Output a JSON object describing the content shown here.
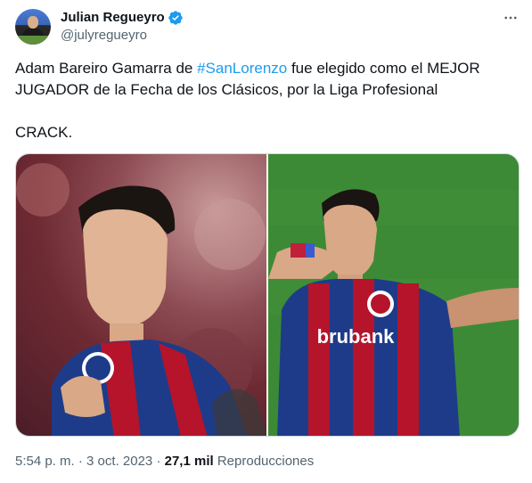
{
  "author": {
    "display_name": "Julian Regueyro",
    "handle": "@julyregueyro",
    "verified": true
  },
  "tweet": {
    "line1_before": "Adam Bareiro Gamarra de ",
    "hashtag": "#SanLorenzo",
    "line1_after": " fue elegido como el MEJOR",
    "line2": "JUGADOR de la Fecha de los Clásicos, por la Liga Profesional",
    "line3": "CRACK."
  },
  "media": {
    "images": [
      {
        "icon": "player-photo-close-up"
      },
      {
        "icon": "player-celebration-photo",
        "shirt_text": "brubank"
      }
    ]
  },
  "footer": {
    "time": "5:54 p. m.",
    "separator1": " · ",
    "date": "3 oct. 2023",
    "separator2": " · ",
    "views_count": "27,1 mil",
    "views_label": " Reproducciones"
  },
  "colors": {
    "accent": "#1d9bf0",
    "text": "#0f1419",
    "secondary": "#536471"
  }
}
